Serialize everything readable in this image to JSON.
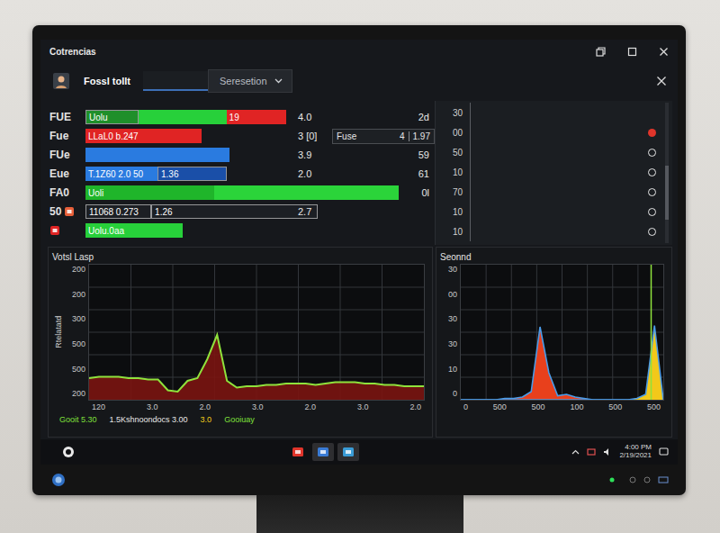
{
  "window": {
    "title": "Cotrencias"
  },
  "tabs": [
    {
      "label": "Fossl tollt",
      "selected": true
    },
    {
      "label": "Seresetion",
      "selected": false
    }
  ],
  "rows": [
    {
      "label": "FUE",
      "segments": [
        {
          "kind": "box",
          "level": 0.17,
          "color": "#1f8f2a",
          "text": "Uolu"
        },
        {
          "kind": "fill",
          "level": 0.28,
          "color": "#27d03a"
        },
        {
          "kind": "fill",
          "level": 0.19,
          "color": "#e02424",
          "text": "19"
        }
      ],
      "value": "4.0",
      "right": "2d"
    },
    {
      "label": "Fue",
      "segments": [
        {
          "kind": "fill",
          "level": 0.37,
          "color": "#e02424",
          "text": "LLaL0 b.247"
        }
      ],
      "value": "3 [0]",
      "field": {
        "label": "Fuse",
        "value": "4",
        "reading": "1.97"
      }
    },
    {
      "label": "FUe",
      "segments": [
        {
          "kind": "fill",
          "level": 0.46,
          "color": "#2a7be0"
        }
      ],
      "value": "3.9",
      "right": "59"
    },
    {
      "label": "Eue",
      "segments": [
        {
          "kind": "fill",
          "level": 0.23,
          "color": "#2a7be0",
          "text": "T.1Z60 2.0 50"
        },
        {
          "kind": "box",
          "level": 0.22,
          "color": "#1a4fa8",
          "text": "1.36"
        }
      ],
      "value": "2.0",
      "right": "61"
    },
    {
      "label": "FA0",
      "segments": [
        {
          "kind": "fill",
          "level": 0.41,
          "color": "#1fb52a",
          "text": "Uoli"
        },
        {
          "kind": "fill",
          "level": 0.59,
          "color": "#2bd43a"
        }
      ],
      "right": "0l"
    },
    {
      "label": "50",
      "icon": {
        "color": "#e8603a"
      },
      "segments": [
        {
          "kind": "box",
          "level": 0.21,
          "color": "#1c1f24",
          "text": "11068 0.273"
        },
        {
          "kind": "box",
          "level": 0.53,
          "color": "#1c1f24",
          "text": "1.26"
        }
      ],
      "value": "2.7"
    },
    {
      "icon": {
        "color": "#e02424"
      },
      "segments": [
        {
          "kind": "fill",
          "level": 0.31,
          "color": "#27d03a",
          "text": "Uolu.0aa"
        }
      ]
    }
  ],
  "side_panel": {
    "entries": [
      {
        "tick": "30"
      },
      {
        "tick": "00",
        "marker": {
          "filled": true,
          "color": "#e0352b"
        }
      },
      {
        "tick": "50",
        "marker": {
          "filled": false,
          "color": "#e8e8e8"
        }
      },
      {
        "tick": "10",
        "marker": {
          "filled": false,
          "color": "#e8e8e8"
        }
      },
      {
        "tick": "70",
        "marker": {
          "filled": false,
          "color": "#e8e8e8"
        }
      },
      {
        "tick": "10",
        "marker": {
          "filled": false,
          "color": "#e8e8e8"
        }
      },
      {
        "tick": "10",
        "marker": {
          "filled": false,
          "color": "#e8e8e8"
        }
      }
    ]
  },
  "load_chart": {
    "title": "Votsl Lasp",
    "y_label": "Rtelatatd",
    "y_ticks": [
      "200",
      "200",
      "300",
      "500",
      "500",
      "200"
    ],
    "x_ticks": [
      "120",
      "3.0",
      "2.0",
      "3.0",
      "2.0",
      "3.0",
      "2.0"
    ],
    "series": [
      {
        "values": [
          16,
          17,
          17,
          17,
          16,
          16,
          15,
          15,
          7,
          6,
          14,
          16,
          30,
          48,
          14,
          9,
          10,
          10,
          11,
          11,
          12,
          12,
          12,
          11,
          12,
          13,
          13,
          13,
          12,
          12,
          11,
          11,
          10,
          10,
          10
        ]
      }
    ],
    "legend": [
      {
        "text": "Gooit 5.30",
        "color": "#7fe03a"
      },
      {
        "text": "1.5Kshnoondocs 3.00",
        "color": "#e8e8e8"
      },
      {
        "text": "3.0",
        "color": "#f2d01a"
      },
      {
        "text": "Gooiuay",
        "color": "#7fe03a"
      }
    ]
  },
  "sound_chart": {
    "title": "Seonnd",
    "y_ticks": [
      "30",
      "00",
      "30",
      "30",
      "10",
      "0"
    ],
    "x_ticks": [
      "0",
      "500",
      "500",
      "100",
      "500",
      "500"
    ],
    "series": [
      {
        "values": [
          0,
          0,
          0,
          0,
          0,
          1,
          1,
          2,
          6,
          54,
          20,
          3,
          4,
          2,
          1,
          0,
          0,
          0,
          0,
          0,
          0,
          0,
          0,
          0
        ],
        "color": "#e8401c"
      },
      {
        "values": [
          0,
          0,
          0,
          0,
          0,
          0,
          0,
          0,
          0,
          0,
          0,
          0,
          0,
          0,
          0,
          0,
          0,
          0,
          0,
          0,
          1,
          4,
          55,
          0
        ],
        "color": "#f2c81a"
      }
    ],
    "cursor": {
      "level": 0.94
    }
  },
  "taskbar": {
    "apps": [
      {
        "color": "#e0352b",
        "selected": false
      },
      {
        "color": "#3a7bd5",
        "selected": true
      },
      {
        "color": "#3a9bd5",
        "selected": true
      }
    ],
    "tray_lines": [
      "4:00 PM",
      "2/19/2021"
    ]
  }
}
